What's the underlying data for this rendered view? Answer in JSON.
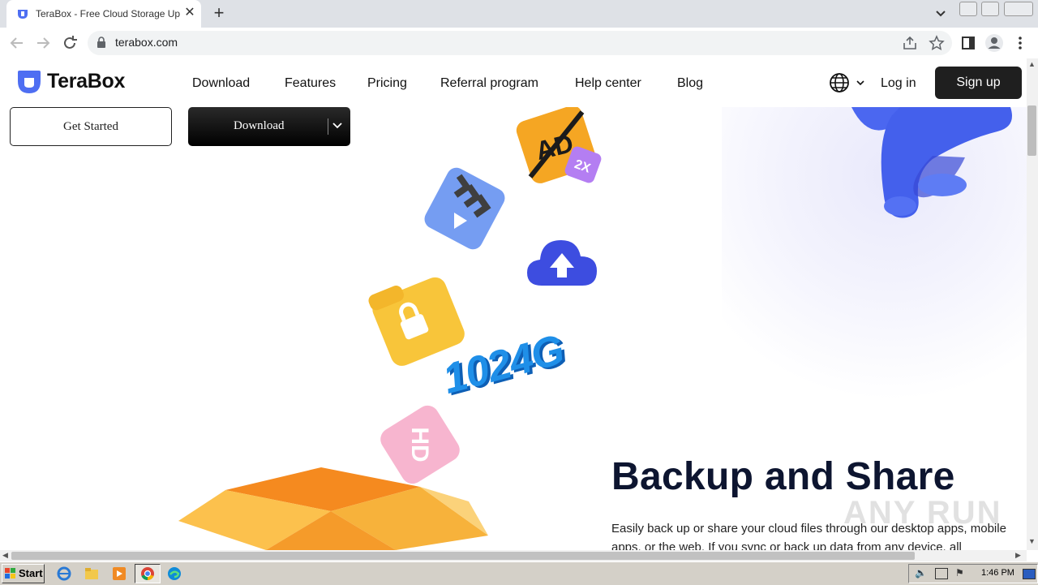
{
  "browser": {
    "tab_title": "TeraBox - Free Cloud Storage Up To",
    "url": "terabox.com"
  },
  "site": {
    "logo": "TeraBox",
    "nav": [
      {
        "label": "Download"
      },
      {
        "label": "Features"
      },
      {
        "label": "Pricing"
      },
      {
        "label": "Referral program"
      },
      {
        "label": "Help center"
      },
      {
        "label": "Blog"
      }
    ],
    "login_label": "Log in",
    "signup_label": "Sign up"
  },
  "hero": {
    "get_started_label": "Get Started",
    "download_label": "Download",
    "storage_badge": "1024G",
    "title": "Backup and Share",
    "text": "Easily back up or share your cloud files through our desktop apps, mobile apps, or the web. If you sync or back up data from any device, all"
  },
  "taskbar": {
    "start_label": "Start",
    "clock": "1:46 PM"
  },
  "watermark": "ANY RUN",
  "colors": {
    "brand": "#4e6ef2",
    "signup_bg": "#1f1f1f",
    "title": "#0d1530",
    "badge": "#1f8fe8"
  }
}
